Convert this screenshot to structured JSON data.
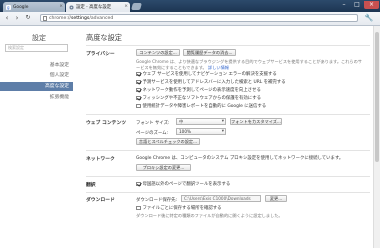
{
  "tabs": [
    {
      "title": "Google",
      "active": false
    },
    {
      "title": "設定 - 高度な設定",
      "active": true
    }
  ],
  "toolbar": {
    "url_scheme": "chrome://",
    "url_host": "settings",
    "url_path": "/advanced"
  },
  "sidebar": {
    "title": "設定",
    "search_placeholder": "検索設定",
    "items": [
      {
        "label": "基本設定",
        "selected": false
      },
      {
        "label": "個人設定",
        "selected": false
      },
      {
        "label": "高度な設定",
        "selected": true
      },
      {
        "label": "拡張機能",
        "selected": false
      }
    ]
  },
  "main": {
    "title": "高度な設定",
    "privacy": {
      "label": "プライバシー",
      "content_settings_button": "コンテンツの設定...",
      "clear_browsing_button": "閲覧履歴データの消去...",
      "description": "Google Chrome は、より快適なブラウジングを提供する目的でウェブサービスを使用することがあります。これらのサービスを無効にすることもできます。",
      "learn_more": "詳しい情報",
      "checkboxes": [
        {
          "label": "ウェブ サービスを使用してナビゲーション エラーの解決を支援する",
          "checked": true
        },
        {
          "label": "予測サービスを使用してアドレスバーに入力した検索と URL を補完する",
          "checked": true
        },
        {
          "label": "ネットワーク動作を予測してページの表示速度を向上させる",
          "checked": true
        },
        {
          "label": "フィッシングや不正なソフトウェアからの保護を有効にする",
          "checked": true
        },
        {
          "label": "使用統計データや障害レポートを自動的に Google に送信する",
          "checked": false
        }
      ]
    },
    "web_content": {
      "label": "ウェブ コンテンツ",
      "font_size_label": "フォント サイズ:",
      "font_size_value": "中",
      "customize_fonts_button": "フォントをカスタマイズ...",
      "page_zoom_label": "ページのズーム:",
      "page_zoom_value": "100%",
      "language_button": "言語とスペルチェックの設定..."
    },
    "network": {
      "label": "ネットワーク",
      "description": "Google Chrome は、コンピュータのシステム プロキシ設定を使用してネットワークに接続しています。",
      "proxy_button": "プロキシ設定の変更..."
    },
    "translate": {
      "label": "翻訳",
      "checkbox_label": "母国語以外のページで翻訳ツールを表示する",
      "checked": true
    },
    "downloads": {
      "label": "ダウンロード",
      "location_label": "ダウンロード保存先:",
      "location_value": "C:\\Users\\Exis C1000\\Downloads",
      "change_button": "変更...",
      "ask_label": "ファイルごとに保存する場所を確認する",
      "ask_checked": false,
      "auto_open_note": "ダウンロード後に特定の種類のファイルが自動的に開くように設定しました。"
    }
  },
  "colors": {
    "titlebar": "#1d3552",
    "sidebar_selected": "#5e7ea8",
    "link": "#3366cc"
  }
}
